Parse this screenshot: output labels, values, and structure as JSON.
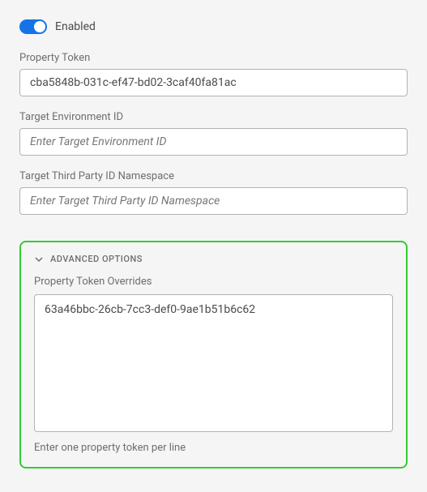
{
  "toggle": {
    "label": "Enabled",
    "checked": true
  },
  "fields": {
    "propertyToken": {
      "label": "Property Token",
      "value": "cba5848b-031c-ef47-bd02-3caf40fa81ac",
      "placeholder": ""
    },
    "targetEnvironmentId": {
      "label": "Target Environment ID",
      "value": "",
      "placeholder": "Enter Target Environment ID"
    },
    "targetThirdPartyIdNamespace": {
      "label": "Target Third Party ID Namespace",
      "value": "",
      "placeholder": "Enter Target Third Party ID Namespace"
    }
  },
  "advanced": {
    "title": "ADVANCED OPTIONS",
    "expanded": true,
    "propertyTokenOverrides": {
      "label": "Property Token Overrides",
      "value": "63a46bbc-26cb-7cc3-def0-9ae1b51b6c62",
      "helpText": "Enter one property token per line"
    }
  }
}
